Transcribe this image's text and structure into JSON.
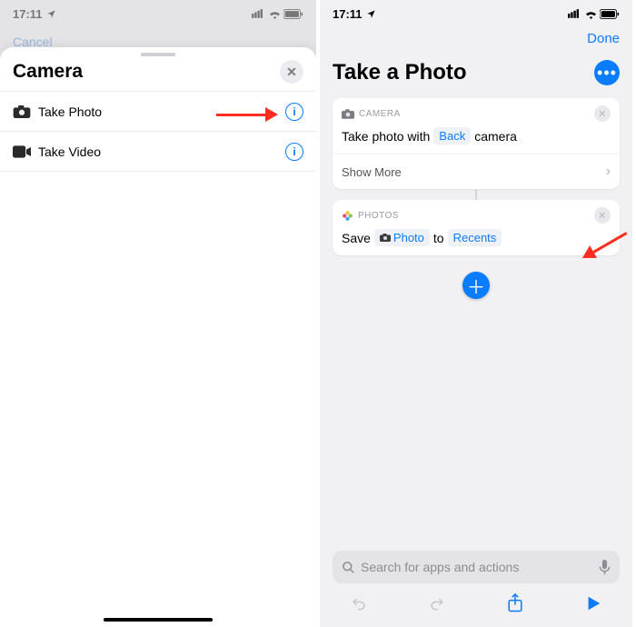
{
  "status": {
    "time": "17:11"
  },
  "left": {
    "cancel": "Cancel",
    "sheet_title": "Camera",
    "actions": [
      {
        "label": "Take Photo"
      },
      {
        "label": "Take Video"
      }
    ]
  },
  "right": {
    "done": "Done",
    "title": "Take a Photo",
    "camera_section": "CAMERA",
    "camera_row_prefix": "Take photo with",
    "camera_pill": "Back",
    "camera_row_suffix": "camera",
    "show_more": "Show More",
    "photos_section": "PHOTOS",
    "save_prefix": "Save",
    "save_variable": "Photo",
    "save_mid": "to",
    "save_album": "Recents",
    "search_placeholder": "Search for apps and actions"
  }
}
